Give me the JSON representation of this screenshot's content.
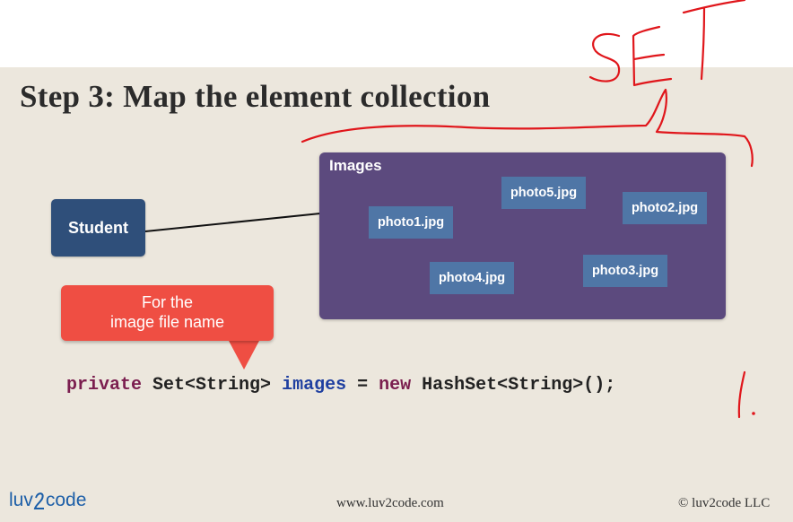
{
  "slide": {
    "title": "Step 3: Map the element collection",
    "student_label": "Student",
    "images_label": "Images",
    "photos": [
      "photo5.jpg",
      "photo2.jpg",
      "photo1.jpg",
      "photo4.jpg",
      "photo3.jpg"
    ],
    "callout_line1": "For the",
    "callout_line2": "image file name",
    "code": {
      "kw_private": "private",
      "type_set": "Set<String>",
      "var_images": "images",
      "equals": "=",
      "kw_new": "new",
      "ctor": "HashSet<String>();"
    }
  },
  "footer": {
    "logo_left": "luv",
    "logo_right": "code",
    "website": "www.luv2code.com",
    "copyright": "© luv2code LLC"
  },
  "annotations": {
    "handwritten_word": "SET",
    "handwritten_mark": "1.",
    "ink_color": "#e0161b"
  },
  "colors": {
    "background": "#ece7dd",
    "student_box": "#2f4f7a",
    "images_box": "#5c4a7e",
    "photo_box": "#4f76a6",
    "callout": "#ef4e43",
    "keyword": "#7b1e4f",
    "variable": "#1f3fa0"
  }
}
